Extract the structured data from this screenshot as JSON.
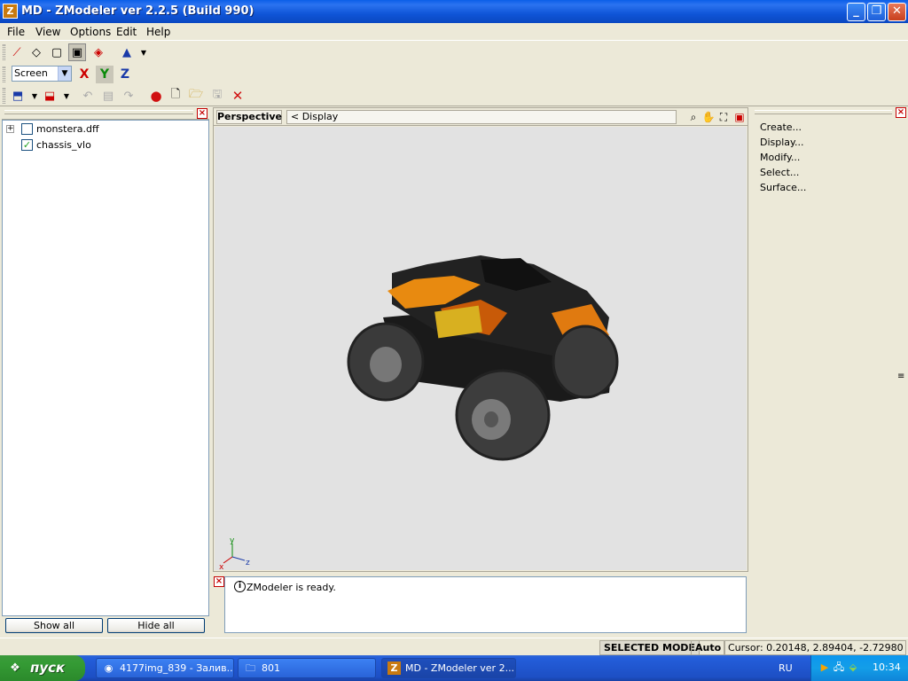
{
  "window": {
    "title": "MD - ZModeler ver 2.2.5 (Build 990)",
    "icon_letter": "Z"
  },
  "menu": {
    "items": [
      "File",
      "View",
      "Options",
      "Edit",
      "Help"
    ]
  },
  "toolbar": {
    "coord_space": "Screen",
    "axis_x": "X",
    "axis_y": "Y",
    "axis_z": "Z"
  },
  "tree": {
    "items": [
      {
        "label": "monstera.dff",
        "checked": false,
        "expandable": true
      },
      {
        "label": "chassis_vlo",
        "checked": true,
        "expandable": false
      }
    ],
    "show_all": "Show all",
    "hide_all": "Hide all"
  },
  "viewport": {
    "mode": "Perspective",
    "display": "<  Display",
    "axis_y": "y",
    "axis_x": "x",
    "axis_z": "z"
  },
  "console": {
    "message": "ZModeler is ready."
  },
  "right_panel": {
    "items": [
      "Create...",
      "Display...",
      "Modify...",
      "Select...",
      "Surface..."
    ]
  },
  "status": {
    "mode": "SELECTED MODE",
    "snap": "Auto",
    "cursor": "Cursor: 0.20148, 2.89404, -2.72980"
  },
  "taskbar": {
    "start": "пуск",
    "tasks": [
      "4177img_839 - Залив...",
      "801",
      "MD - ZModeler ver 2...."
    ],
    "lang": "RU",
    "clock": "10:34"
  }
}
